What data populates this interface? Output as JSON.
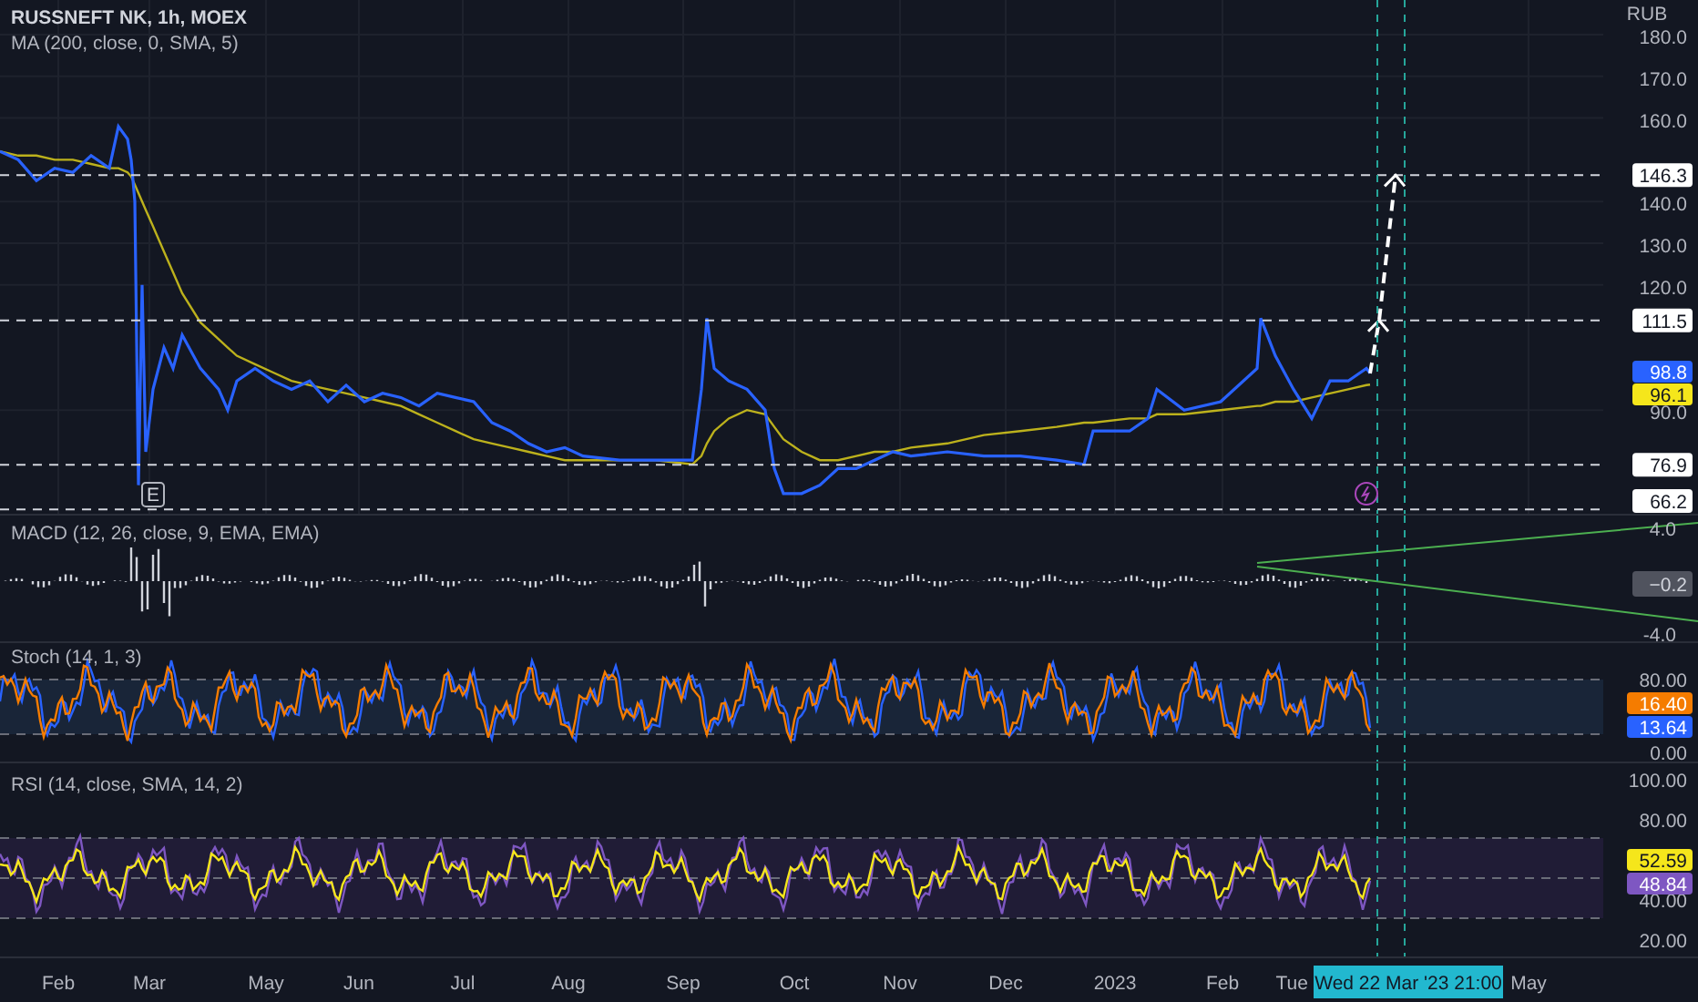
{
  "header": {
    "symbol": "RUSSNEFT NK, 1h, MOEX",
    "indicator": "MA (200, close, 0, SMA, 5)"
  },
  "price_chart": {
    "currency": "RUB",
    "axis_labels": [
      "180.0",
      "170.0",
      "160.0",
      "140.0",
      "130.0",
      "120.0",
      "90.0"
    ],
    "levels": [
      {
        "label": "146.3"
      },
      {
        "label": "111.5"
      },
      {
        "label": "76.9"
      },
      {
        "label": "66.2"
      }
    ],
    "last_values": [
      {
        "text": "98.8",
        "color": "#2962ff"
      },
      {
        "text": "96.1",
        "color": "#f5e61b"
      }
    ],
    "events": [
      {
        "kind": "earnings",
        "label": "E"
      },
      {
        "kind": "flash"
      }
    ]
  },
  "macd": {
    "title": "MACD (12, 26, close, 9, EMA, EMA)",
    "ticks": [
      "4.0",
      "-4.0"
    ],
    "value_label": "−0.2"
  },
  "stoch": {
    "title": "Stoch (14, 1, 3)",
    "ticks": [
      "80.00",
      "0.00"
    ],
    "labels": [
      {
        "text": "16.40",
        "color": "#f57c00"
      },
      {
        "text": "13.64",
        "color": "#2962ff"
      }
    ]
  },
  "rsi": {
    "title": "RSI (14, close, SMA, 14, 2)",
    "ticks": [
      "100.00",
      "80.00",
      "40.00",
      "20.00"
    ],
    "labels": [
      {
        "text": "52.59",
        "color": "#f5e61b"
      },
      {
        "text": "48.84",
        "color": "#7e57c2"
      }
    ]
  },
  "time_axis": {
    "labels": [
      "Feb",
      "Mar",
      "May",
      "Jun",
      "Jul",
      "Aug",
      "Sep",
      "Oct",
      "Nov",
      "Dec",
      "2023",
      "Feb",
      "May"
    ],
    "behind_label": "Tue",
    "crosshair_label": "Wed 22 Mar '23   21:00"
  }
}
